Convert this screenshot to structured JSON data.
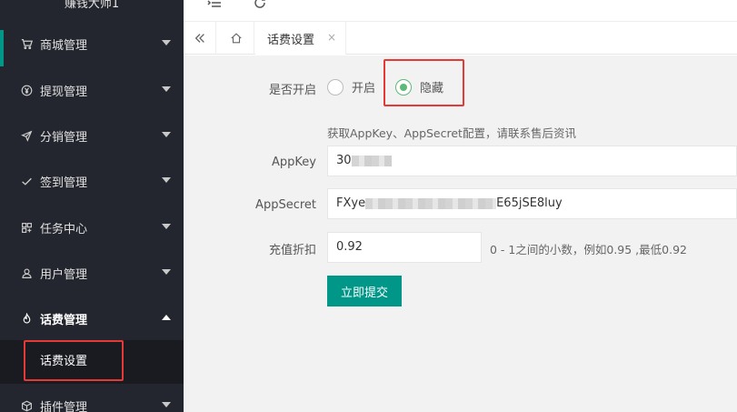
{
  "sidebar": {
    "brand": "赚钱大师1",
    "items": [
      {
        "label": "商城管理",
        "icon": "cart-icon"
      },
      {
        "label": "提现管理",
        "icon": "yen-icon"
      },
      {
        "label": "分销管理",
        "icon": "send-icon"
      },
      {
        "label": "签到管理",
        "icon": "check-icon"
      },
      {
        "label": "任务中心",
        "icon": "apps-icon"
      },
      {
        "label": "用户管理",
        "icon": "user-icon"
      },
      {
        "label": "话费管理",
        "icon": "fire-icon"
      },
      {
        "label": "插件管理",
        "icon": "cube-icon"
      }
    ],
    "submenu": {
      "label": "话费设置"
    }
  },
  "tabs": {
    "active": {
      "label": "话费设置",
      "close": "×"
    }
  },
  "form": {
    "enable": {
      "label": "是否开启",
      "options": [
        {
          "label": "开启",
          "checked": false
        },
        {
          "label": "隐藏",
          "checked": true
        }
      ]
    },
    "hint": "获取AppKey、AppSecret配置，请联系售后资讯",
    "appkey": {
      "label": "AppKey",
      "value_prefix": "30"
    },
    "appsecret": {
      "label": "AppSecret",
      "value_prefix": "FXye",
      "value_suffix": "E65jSE8luy"
    },
    "discount": {
      "label": "充值折扣",
      "value": "0.92",
      "help": "0 - 1之间的小数，例如0.95 ,最低0.92"
    },
    "submit": {
      "label": "立即提交"
    }
  },
  "colors": {
    "sidebar_bg": "#23262e",
    "accent": "#009688",
    "radio_checked": "#5fb878",
    "highlight": "#e53935"
  }
}
